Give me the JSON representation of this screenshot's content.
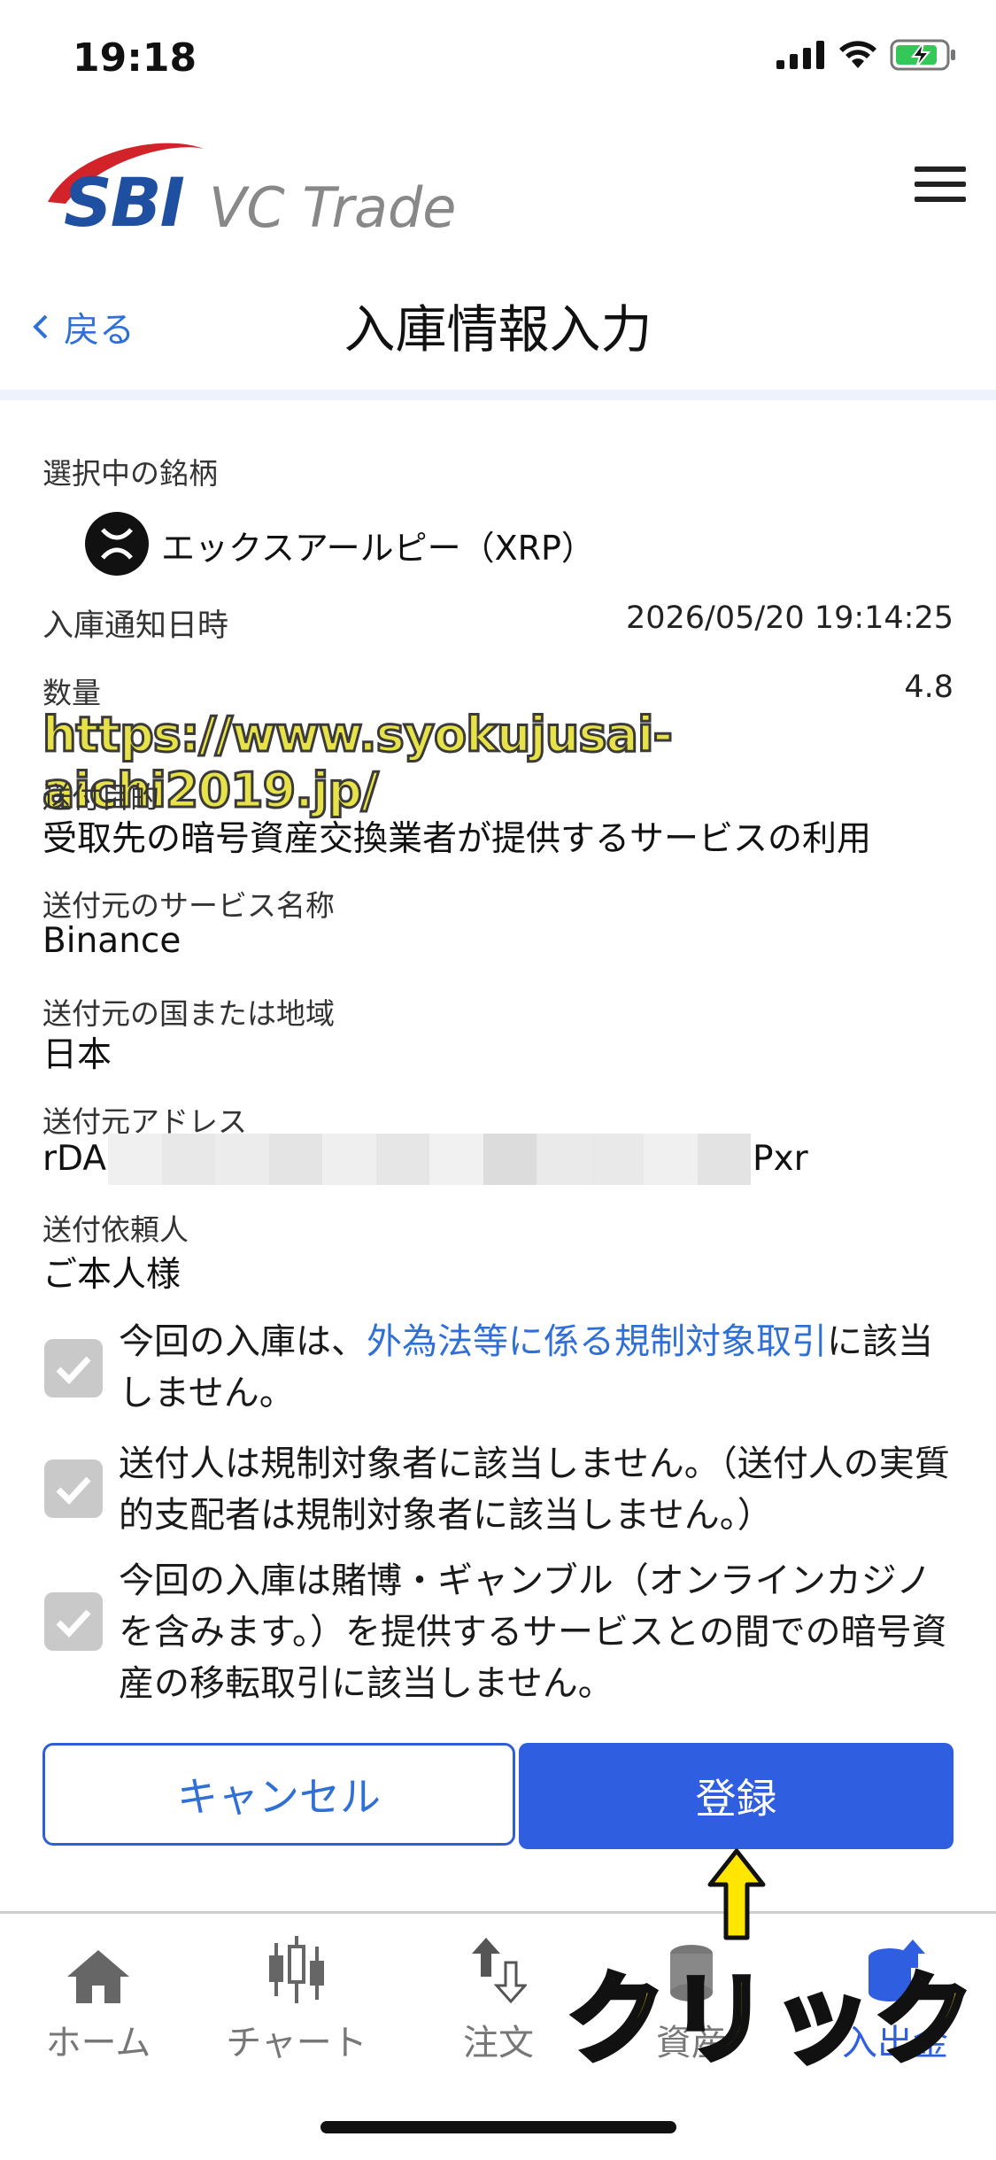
{
  "status": {
    "time": "19:18"
  },
  "header": {
    "logo_primary": "SBI",
    "logo_secondary": "VC Trade",
    "back_label": "戻る",
    "title": "入庫情報入力"
  },
  "asset": {
    "label": "選択中の銘柄",
    "name": "エックスアールピー（XRP）",
    "icon": "xrp-icon"
  },
  "fields": {
    "notice_label": "入庫通知日時",
    "notice_value": "2026/05/20 19:14:25",
    "quantity_label": "数量",
    "quantity_value": "4.8",
    "watermark": "https://www.syokujusai-aichi2019.jp/",
    "purpose_label": "送付目的",
    "purpose_value": "受取先の暗号資産交換業者が提供するサービスの利用",
    "service_label": "送付元のサービス名称",
    "service_value": "Binance",
    "country_label": "送付元の国または地域",
    "country_value": "日本",
    "address_label": "送付元アドレス",
    "address_prefix": "rDA",
    "address_suffix": "Pxr",
    "requester_label": "送付依頼人",
    "requester_value": "ご本人様"
  },
  "checks": {
    "c1_pre": "今回の入庫は、",
    "c1_link": "外為法等に係る規制対象取引",
    "c1_post": "に該当しません。",
    "c2": "送付人は規制対象者に該当しません。（送付人の実質的支配者は規制対象者に該当しません。）",
    "c3": "今回の入庫は賭博・ギャンブル（オンラインカジノを含みます。）を提供するサービスとの間での暗号資産の移転取引に該当しません。"
  },
  "buttons": {
    "cancel": "キャンセル",
    "register": "登録"
  },
  "tabs": {
    "home": "ホーム",
    "chart": "チャート",
    "order": "注文",
    "assets": "資産",
    "deposit": "入出金"
  },
  "annotation": {
    "click": "クリック"
  },
  "colors": {
    "accent": "#2f5fe0",
    "link": "#2f6fd6",
    "annotation": "#ffe600"
  }
}
